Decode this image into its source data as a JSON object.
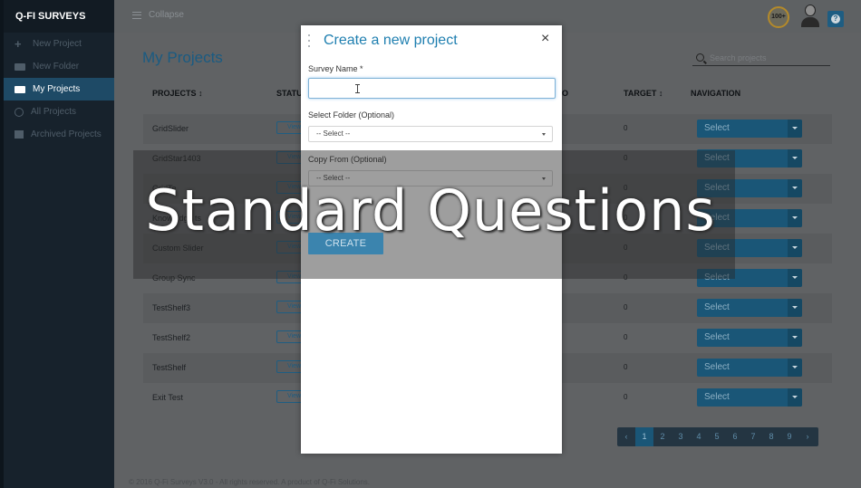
{
  "brand": "Q-FI SURVEYS",
  "sidebar": {
    "items": [
      {
        "label": "New Project",
        "icon": "plus-icon",
        "active": false
      },
      {
        "label": "New Folder",
        "icon": "folder-icon",
        "active": false
      },
      {
        "label": "My Projects",
        "icon": "folder-open-icon",
        "active": true
      },
      {
        "label": "All Projects",
        "icon": "globe-icon",
        "active": false
      },
      {
        "label": "Archived Projects",
        "icon": "archive-icon",
        "active": false
      }
    ]
  },
  "topbar": {
    "collapse_label": "Collapse",
    "points_badge": "100+"
  },
  "main": {
    "title": "My Projects",
    "search_placeholder": "Search projects",
    "columns": {
      "projects": "PROJECTS ↕",
      "status": "STATU",
      "o": "O",
      "target": "TARGET ↕",
      "navigation": "NAVIGATION"
    },
    "rows": [
      {
        "name": "GridSlider",
        "view": "View",
        "target": "0",
        "select": "Select"
      },
      {
        "name": "GridStar1403",
        "view": "View",
        "target": "0",
        "select": "Select"
      },
      {
        "name": "GridTe",
        "view": "View",
        "target": "0",
        "select": "Select"
      },
      {
        "name": "Knowledge ts",
        "view": "View",
        "target": "0",
        "select": "Select"
      },
      {
        "name": "Custom Slider",
        "view": "View",
        "target": "0",
        "select": "Select"
      },
      {
        "name": "Group Sync",
        "view": "View",
        "target": "0",
        "select": "Select"
      },
      {
        "name": "TestShelf3",
        "view": "View",
        "target": "0",
        "select": "Select"
      },
      {
        "name": "TestShelf2",
        "view": "View",
        "target": "0",
        "select": "Select"
      },
      {
        "name": "TestShelf",
        "view": "View",
        "target": "0",
        "select": "Select"
      },
      {
        "name": "Exit Test",
        "view": "View",
        "target": "0",
        "select": "Select"
      }
    ],
    "pagination": {
      "prev": "‹",
      "pages": [
        "1",
        "2",
        "3",
        "4",
        "5",
        "6",
        "7",
        "8",
        "9"
      ],
      "next": "›",
      "current": "1"
    },
    "footer": "© 2016 Q-Fi Surveys V3.0 - All rights reserved. A product of Q-Fi Solutions."
  },
  "modal": {
    "title": "Create a new project",
    "close": "×",
    "survey_name_label": "Survey Name *",
    "survey_name_value": "",
    "folder_label": "Select Folder (Optional)",
    "folder_value": "-- Select --",
    "copy_label": "Copy From (Optional)",
    "copy_value": "-- Select --",
    "create_label": "CREATE"
  },
  "overlay_caption": "Standard Questions",
  "colors": {
    "accent": "#1f7fb0",
    "select_button": "#1a5677",
    "sidebar_active": "#1e4a66"
  }
}
